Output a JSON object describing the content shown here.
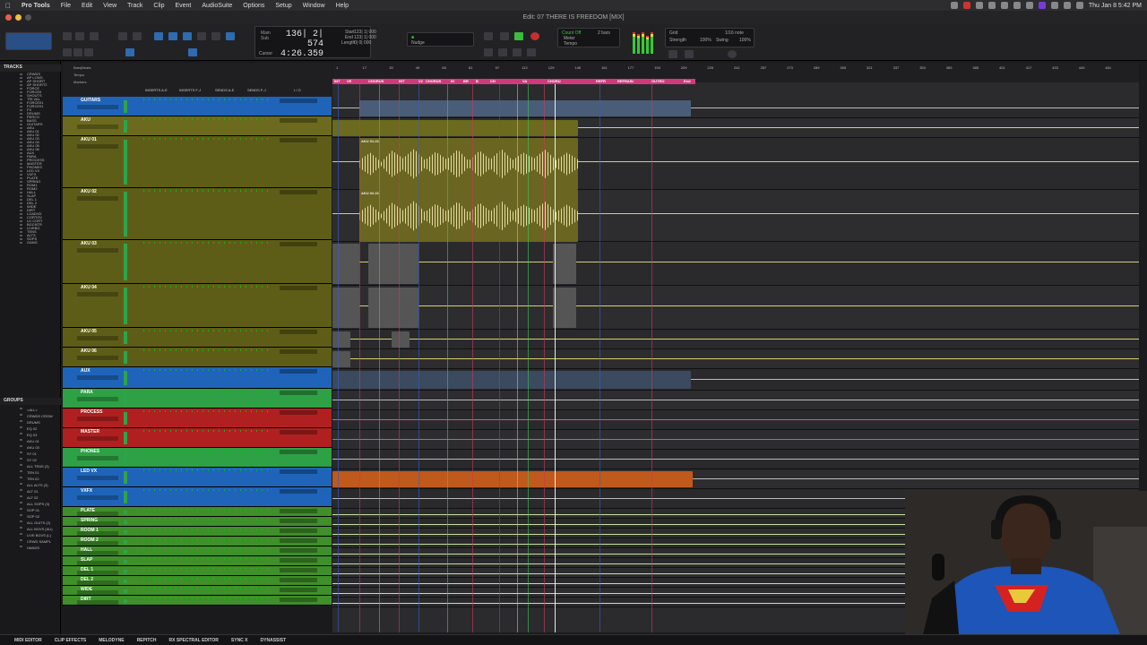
{
  "menubar": {
    "app": "Pro Tools",
    "items": [
      "File",
      "Edit",
      "View",
      "Track",
      "Clip",
      "Event",
      "AudioSuite",
      "Options",
      "Setup",
      "Window",
      "Help"
    ],
    "clock": "Thu Jan 8  5:42 PM"
  },
  "window": {
    "title": "Edit: 07 THERE IS FREEDOM [MIX]"
  },
  "toolbar": {
    "counter_label_main": "Main",
    "counter_label_sub": "Sub",
    "counter_main": "136| 2| 574",
    "counter_sub": "4:26.359",
    "cursor_label": "Cursor",
    "start_label": "Start",
    "end_label": "End",
    "length_label": "Length",
    "start_val": "123| 1| 000",
    "end_val": "123| 1| 000",
    "length_val": "0| 0| 000",
    "nudge_label": "Nudge",
    "grid_label": "Grid",
    "grid_val": "1/16 note",
    "strength_label": "Strength",
    "strength_val": "100%",
    "swing_label": "Swing",
    "swing_val": "100%",
    "countoff": "Count Off",
    "meter": "Meter",
    "tempo": "Tempo",
    "bars": "2 bars"
  },
  "sidebar": {
    "tracks_title": "TRACKS",
    "tracks": [
      "CRWDS",
      "AP LONG",
      "AP SHORT",
      "AP SHORT2",
      "FORCE",
      "FORCE0",
      "SHOUTS",
      "TRI VAL",
      "FORCE01",
      "FORCE01",
      "FX",
      "DRUMS",
      "PERCS",
      "BASS",
      "GUITARS",
      "AKU",
      "AKU 01",
      "AKU 02",
      "AKU 03",
      "AKU 04",
      "AKU 05",
      "AKU 06",
      "AUX",
      "PARA",
      "PROCESS",
      "MASTER",
      "PHONES",
      "LED VX",
      "VXFX",
      "PLATE",
      "SPRING",
      "ROM1",
      "ROM2",
      "HALL",
      "SLAP",
      "DEL 1",
      "DEL 2",
      "WIDE",
      "DIRT",
      "LOADVD",
      "CORTOV",
      "LD CORT",
      "BGCNTR",
      "LIVEBG",
      "TENS",
      "ALTS",
      "SOPS",
      "GANG"
    ],
    "groups_title": "GROUPS",
    "groups": [
      "<ALL>",
      "CRWDS CROW",
      "DRUMS",
      "EQ 02",
      "EQ 03",
      "AKU 01",
      "AKU 03",
      "SY 01",
      "SY 02",
      "ALL TENS (3)",
      "TEN 01",
      "TEN 02",
      "ALL ALTS (3)",
      "ALT 01",
      "ALT 02",
      "ALL SOPS (3)",
      "SOP 01",
      "SOP 02",
      "ALL GUITS (2)",
      "ALL BGVS (AU)",
      "LIVE BGVS (L)",
      "CRWD SAMPL",
      "HANDS"
    ]
  },
  "track_header": {
    "ruler_rows": [
      "Bars|Beats",
      "Tempo",
      "Markers"
    ],
    "columns": [
      "INSERTS A-E",
      "INSERTS F-J",
      "SENDS A-E",
      "SENDS F-J",
      "I / O"
    ]
  },
  "tracks": [
    {
      "name": "GUITARS",
      "color": "#1f64b8",
      "h": 22
    },
    {
      "name": "AKU",
      "color": "#6b6a1e",
      "h": 22
    },
    {
      "name": "AKU 01",
      "color": "#5e5d18",
      "h": 58
    },
    {
      "name": "AKU 02",
      "color": "#5e5d18",
      "h": 58
    },
    {
      "name": "AKU 03",
      "color": "#5e5d18",
      "h": 49
    },
    {
      "name": "AKU 04",
      "color": "#5e5d18",
      "h": 49
    },
    {
      "name": "AKU 05",
      "color": "#5e5d18",
      "h": 22
    },
    {
      "name": "AKU 06",
      "color": "#5e5d18",
      "h": 22
    },
    {
      "name": "AUX",
      "color": "#1f64b8",
      "h": 24
    },
    {
      "name": "PARA",
      "color": "#2ea045",
      "h": 22
    },
    {
      "name": "PROCESS",
      "color": "#b02020",
      "h": 22
    },
    {
      "name": "MASTER",
      "color": "#b02020",
      "h": 22
    },
    {
      "name": "PHONES",
      "color": "#2ea045",
      "h": 22
    },
    {
      "name": "LED VX",
      "color": "#1f64b8",
      "h": 22
    },
    {
      "name": "VXFX",
      "color": "#1f64b8",
      "h": 22
    },
    {
      "name": "PLATE",
      "color": "#3f8f2a",
      "h": 11
    },
    {
      "name": "SPRING",
      "color": "#3f8f2a",
      "h": 11
    },
    {
      "name": "ROOM 1",
      "color": "#3f8f2a",
      "h": 11
    },
    {
      "name": "ROOM 2",
      "color": "#3f8f2a",
      "h": 11
    },
    {
      "name": "HALL",
      "color": "#3f8f2a",
      "h": 11
    },
    {
      "name": "SLAP",
      "color": "#3f8f2a",
      "h": 11
    },
    {
      "name": "DEL 1",
      "color": "#3f8f2a",
      "h": 11
    },
    {
      "name": "DEL 2",
      "color": "#3f8f2a",
      "h": 11
    },
    {
      "name": "WIDE",
      "color": "#3f8f2a",
      "h": 11
    },
    {
      "name": "DIRT",
      "color": "#3f8f2a",
      "h": 11
    }
  ],
  "timeline": {
    "bars": [
      "1",
      "17",
      "33",
      "49",
      "65",
      "81",
      "97",
      "113",
      "129",
      "145",
      "161",
      "177",
      "193",
      "209",
      "225",
      "241",
      "257",
      "273",
      "289",
      "305",
      "321",
      "337",
      "353",
      "369",
      "385",
      "401",
      "417",
      "433",
      "449",
      "461"
    ],
    "markers": [
      "INT",
      "VE",
      "CHORUS",
      "INT",
      "V2",
      "CHORUS",
      "IN",
      "BR",
      "B",
      "CH",
      "VA",
      "CHORU",
      "REFR",
      "REFRAIN",
      "OUTRO",
      "End"
    ],
    "clips": [
      {
        "label": "AKU 01-01",
        "lane": 2
      },
      {
        "label": "AKU 02-01",
        "lane": 3
      }
    ]
  },
  "bottombar": [
    "MIDI EDITOR",
    "CLIP EFFECTS",
    "MELODYNE",
    "REPITCH",
    "RX SPECTRAL EDITOR",
    "SYNC X",
    "DYNASSIST"
  ]
}
